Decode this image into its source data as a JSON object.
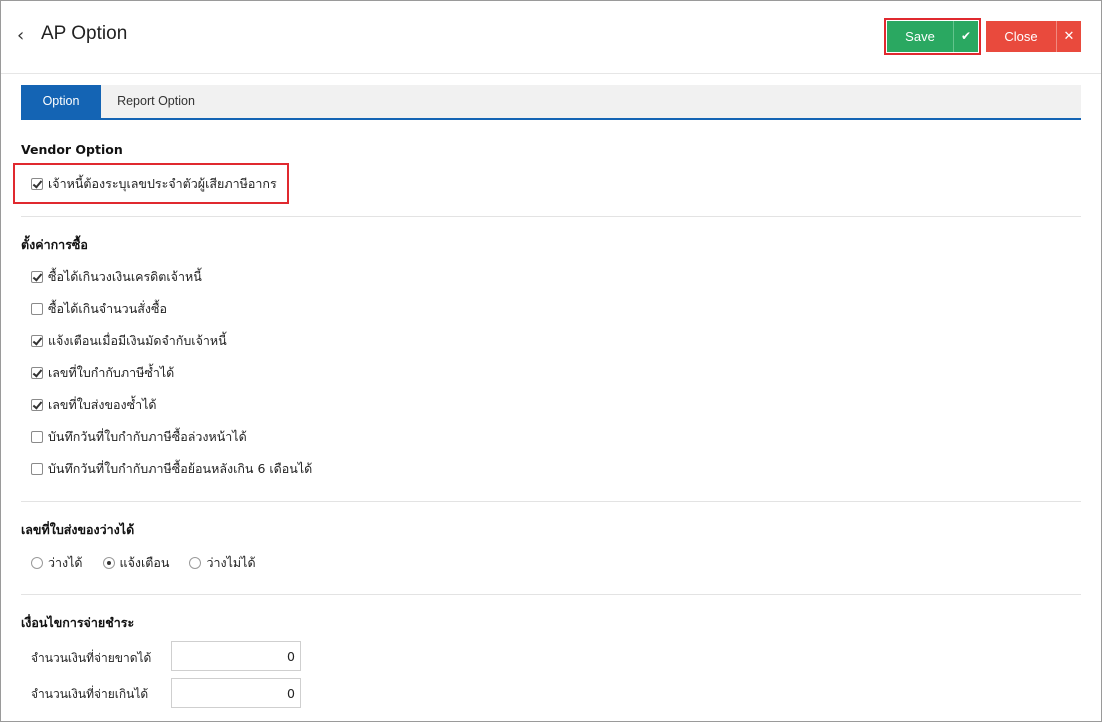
{
  "header": {
    "back_icon": "‹",
    "title": "AP Option",
    "save_label": "Save",
    "save_icon": "✔",
    "close_label": "Close",
    "close_icon": "✕"
  },
  "tabs": [
    {
      "label": "Option",
      "active": true
    },
    {
      "label": "Report Option",
      "active": false
    }
  ],
  "vendor": {
    "title": "Vendor Option",
    "items": [
      {
        "label": "เจ้าหนี้ต้องระบุเลขประจำตัวผู้เสียภาษีอากร",
        "checked": true
      }
    ]
  },
  "purchase": {
    "title": "ตั้งค่าการซื้อ",
    "items": [
      {
        "label": "ซื้อได้เกินวงเงินเครดิตเจ้าหนี้",
        "checked": true
      },
      {
        "label": "ซื้อได้เกินจำนวนสั่งซื้อ",
        "checked": false
      },
      {
        "label": "แจ้งเตือนเมื่อมีเงินมัดจำกับเจ้าหนี้",
        "checked": true
      },
      {
        "label": "เลขที่ใบกำกับภาษีซ้ำได้",
        "checked": true
      },
      {
        "label": "เลขที่ใบส่งของซ้ำได้",
        "checked": true
      },
      {
        "label": "บันทึกวันที่ใบกำกับภาษีซื้อล่วงหน้าได้",
        "checked": false
      },
      {
        "label": "บันทึกวันที่ใบกำกับภาษีซื้อย้อนหลังเกิน 6 เดือนได้",
        "checked": false
      }
    ]
  },
  "delivery": {
    "title": "เลขที่ใบส่งของว่างได้",
    "options": [
      {
        "label": "ว่างได้",
        "checked": false
      },
      {
        "label": "แจ้งเตือน",
        "checked": true
      },
      {
        "label": "ว่างไม่ได้",
        "checked": false
      }
    ]
  },
  "payment": {
    "title": "เงื่อนไขการจ่ายชำระ",
    "fields": [
      {
        "label": "จำนวนเงินที่จ่ายขาดได้",
        "value": "0"
      },
      {
        "label": "จำนวนเงินที่จ่ายเกินได้",
        "value": "0"
      }
    ]
  },
  "colors": {
    "save": "#2aa861",
    "close": "#e94a3d",
    "tab_active": "#1464b4",
    "highlight": "#e0292f"
  }
}
